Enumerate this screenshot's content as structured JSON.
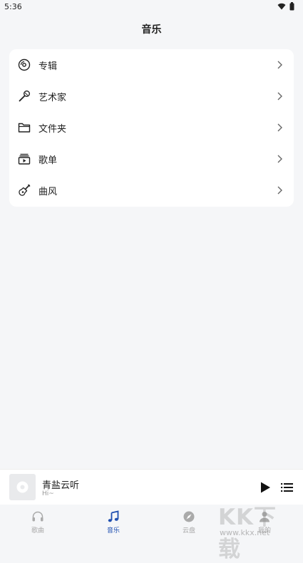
{
  "status_bar": {
    "time": "5:36"
  },
  "app_title": "音乐",
  "menu_items": [
    {
      "label": "专辑",
      "icon": "album-disc-icon"
    },
    {
      "label": "艺术家",
      "icon": "microphone-icon"
    },
    {
      "label": "文件夹",
      "icon": "folder-icon"
    },
    {
      "label": "歌单",
      "icon": "playlist-icon"
    },
    {
      "label": "曲风",
      "icon": "guitar-icon"
    }
  ],
  "now_playing": {
    "title": "青盐云听",
    "subtitle": "Hi~"
  },
  "bottom_nav": [
    {
      "label": "歌曲",
      "icon": "headphones-icon",
      "active": false
    },
    {
      "label": "音乐",
      "icon": "music-note-icon",
      "active": true
    },
    {
      "label": "云盘",
      "icon": "compass-icon",
      "active": false
    },
    {
      "label": "我的",
      "icon": "person-icon",
      "active": false
    }
  ],
  "watermark": {
    "mark": "KK下载",
    "url": "www.kkx.net"
  },
  "colors": {
    "background": "#f5f6f8",
    "card": "#ffffff",
    "accent": "#1f4fb0",
    "inactive": "#aaaaaa"
  }
}
